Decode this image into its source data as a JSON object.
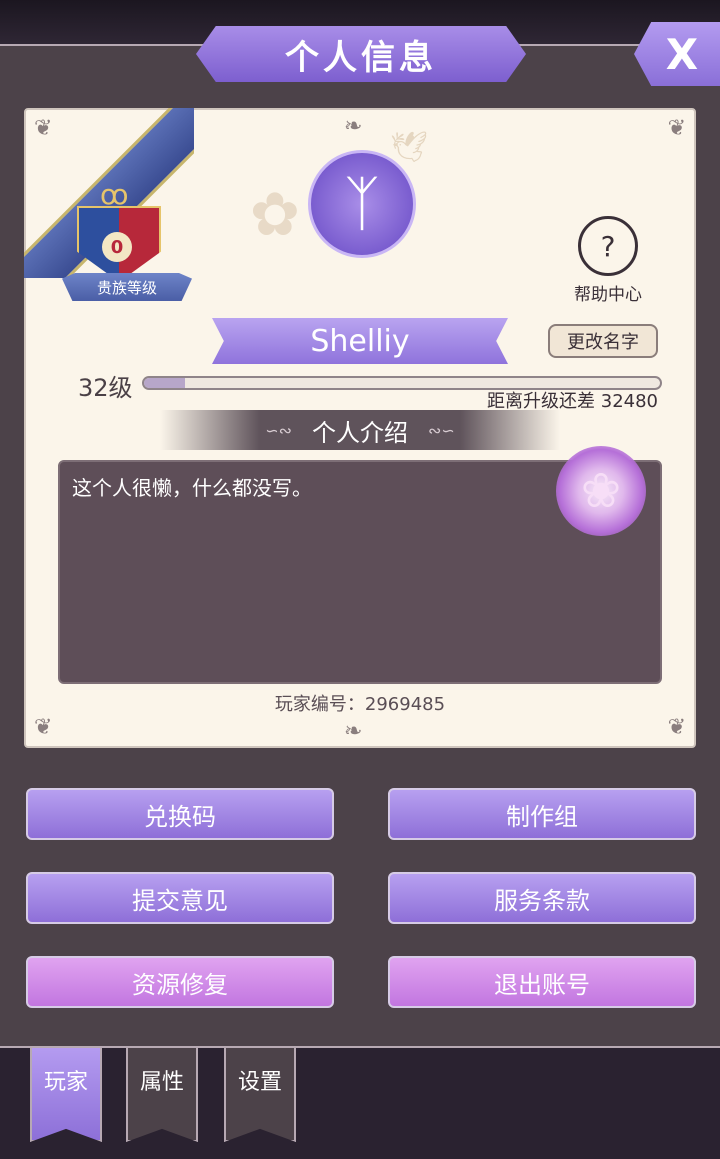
{
  "header": {
    "title": "个人信息",
    "close_label": "X"
  },
  "noble": {
    "level_value": "0",
    "label": "贵族等级"
  },
  "help": {
    "icon_glyph": "?",
    "label": "帮助中心"
  },
  "profile": {
    "name": "Shelliy",
    "rename_label": "更改名字",
    "level_label": "32级",
    "xp_fraction": 0.08,
    "xp_remaining_label": "距离升级还差 32480",
    "intro_title": "个人介绍",
    "intro_text": "这个人很懒，什么都没写。",
    "player_id": "玩家编号：2969485"
  },
  "buttons": {
    "redeem": "兑换码",
    "credits": "制作组",
    "feedback": "提交意见",
    "terms": "服务条款",
    "repair": "资源修复",
    "logout": "退出账号"
  },
  "tabs": [
    {
      "label": "玩家",
      "active": true
    },
    {
      "label": "属性",
      "active": false
    },
    {
      "label": "设置",
      "active": false
    }
  ],
  "colors": {
    "panel": "#4c4249",
    "card": "#fbf5ea",
    "accent_purple": "#8e6fd8",
    "accent_pink": "#c276e0"
  }
}
